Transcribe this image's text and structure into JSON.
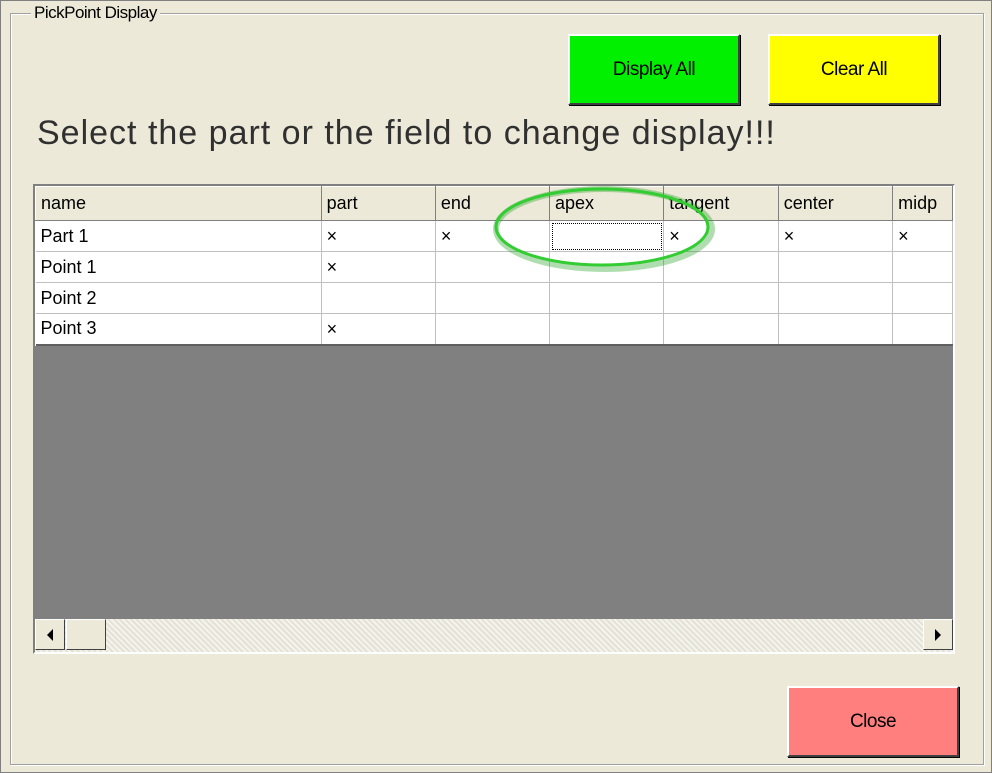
{
  "group": {
    "title": "PickPoint Display"
  },
  "buttons": {
    "display_all": "Display All",
    "clear_all": "Clear All",
    "close": "Close"
  },
  "headline": "Select the part or the field to change display!!!",
  "grid": {
    "columns": [
      "name",
      "part",
      "end",
      "apex",
      "tangent",
      "center",
      "midp"
    ],
    "rows": [
      [
        "Part 1",
        "×",
        "×",
        "",
        "×",
        "×",
        "×"
      ],
      [
        "Point 1",
        "×",
        "",
        "",
        "",
        "",
        ""
      ],
      [
        "Point 2",
        "",
        "",
        "",
        "",
        "",
        ""
      ],
      [
        "Point 3",
        "×",
        "",
        "",
        "",
        "",
        ""
      ]
    ],
    "focused_cell": "Part 1 / apex"
  },
  "colors": {
    "display_all_button": "#00f000",
    "clear_all_button": "#ffff00",
    "close_button": "#ff7f7f",
    "annotation_ellipse": "#33cc33"
  }
}
